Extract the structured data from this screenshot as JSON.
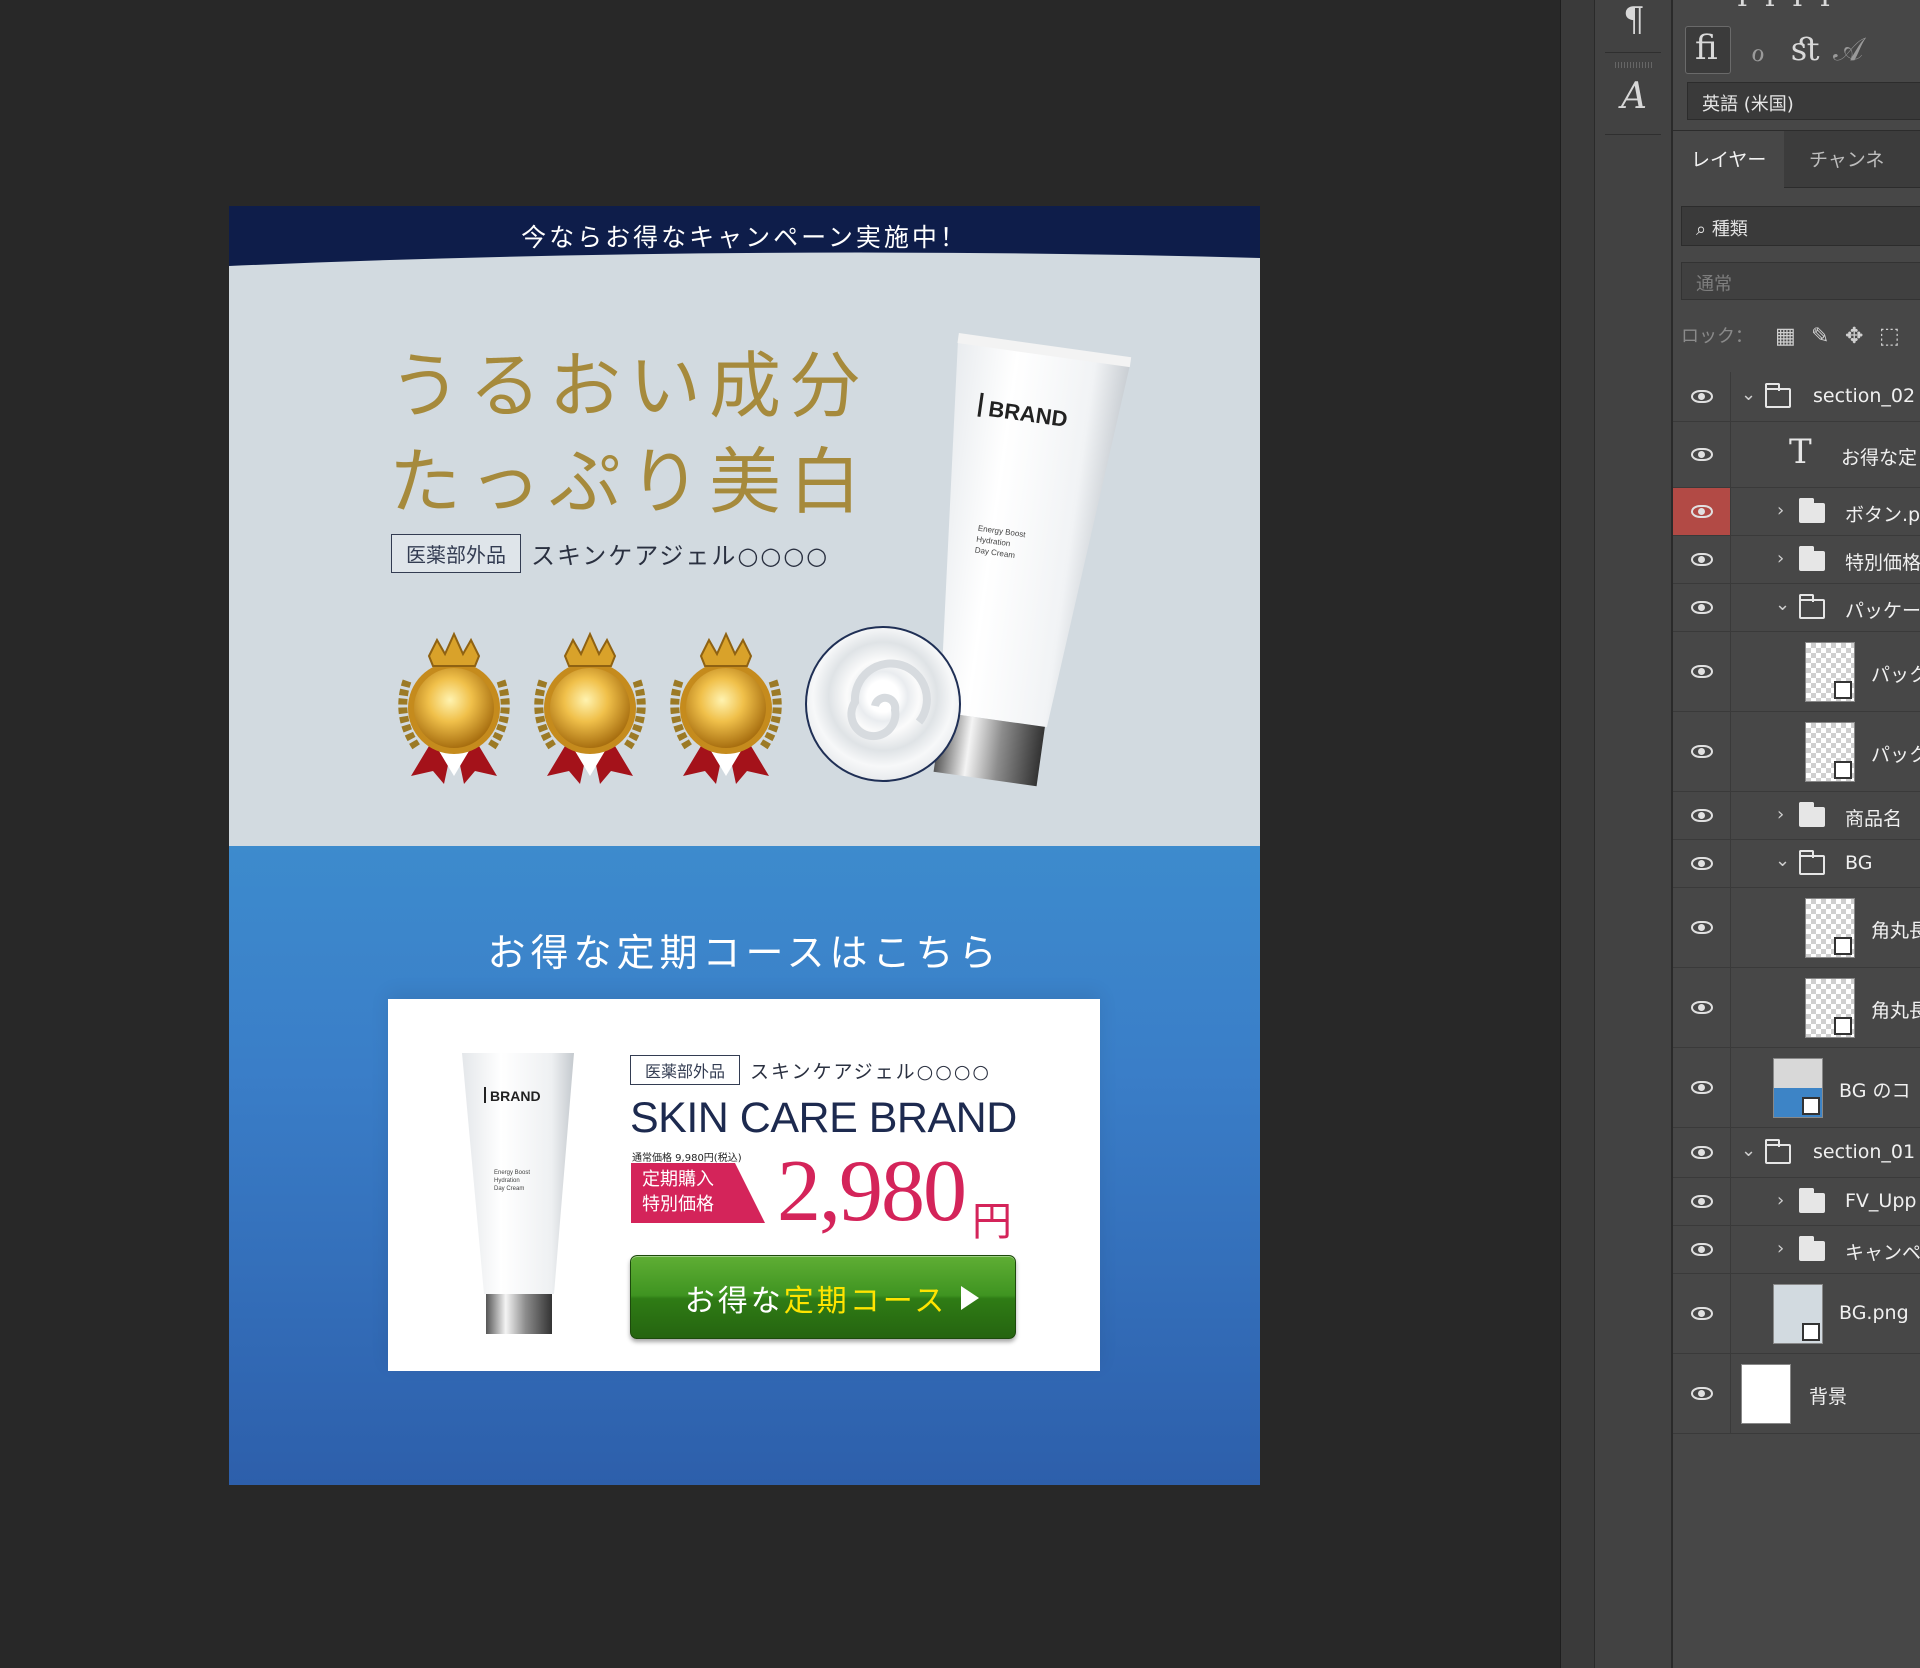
{
  "artboard": {
    "banner_text": "今ならお得なキャンペーン実施中！",
    "headline_line1": "うるおい成分",
    "headline_line2": "たっぷり美白",
    "quasi_drug_badge": "医薬部外品",
    "product_name": "スキンケアジェル○○○○",
    "tube_brand": "BRAND",
    "tube_sub": "Energy Boost\nHydration\nDay Cream",
    "section2_title": "お得な定期コースはこちら",
    "card": {
      "quasi_drug_badge": "医薬部外品",
      "product_name": "スキンケアジェル○○○○",
      "brand_name": "SKIN CARE BRAND",
      "normal_price": "通常価格 9,980円(税込)",
      "tag_line1": "定期購入",
      "tag_line2": "特別価格",
      "price": "2,980",
      "price_unit": "円",
      "cta_plain": "お得な",
      "cta_highlight": "定期コース"
    },
    "colors": {
      "banner_navy": "#0e1d4a",
      "gold": "#a68a3c",
      "light_bg": "#d2dae0",
      "blue_top": "#3d8bcd",
      "blue_bottom": "#2d5fab",
      "price_red": "#d4245a",
      "cta_green": "#3f9421",
      "cta_highlight": "#ffe400"
    }
  },
  "tools": {
    "paragraph_icon": "¶",
    "glyph_icon": "A"
  },
  "char_panel": {
    "ligature_fi": "ﬁ",
    "ligature_o": "ℴ",
    "ligature_st": "ﬆ",
    "swash_a": "𝒜",
    "language": "英語 (米国)"
  },
  "layers_panel": {
    "tabs": [
      "レイヤー",
      "チャンネル"
    ],
    "filter_label": "種類",
    "blend_mode": "通常",
    "lock_label": "ロック：",
    "layers": [
      {
        "name": "section_02",
        "type": "group-open"
      },
      {
        "name": "お得な定",
        "type": "text"
      },
      {
        "name": "ボタン.p",
        "type": "group",
        "selected": true
      },
      {
        "name": "特別価格",
        "type": "group"
      },
      {
        "name": "パッケー",
        "type": "group-open"
      },
      {
        "name": "パック",
        "type": "smart-object"
      },
      {
        "name": "パック",
        "type": "smart-object"
      },
      {
        "name": "商品名",
        "type": "group"
      },
      {
        "name": "BG",
        "type": "group-open"
      },
      {
        "name": "角丸長",
        "type": "shape"
      },
      {
        "name": "角丸長",
        "type": "smart-object"
      },
      {
        "name": "BG のコ",
        "type": "shape"
      },
      {
        "name": "section_01",
        "type": "group-open"
      },
      {
        "name": "FV_Upp",
        "type": "group"
      },
      {
        "name": "キャンペ",
        "type": "group"
      },
      {
        "name": "BG.png",
        "type": "image"
      },
      {
        "name": "背景",
        "type": "background"
      }
    ]
  }
}
